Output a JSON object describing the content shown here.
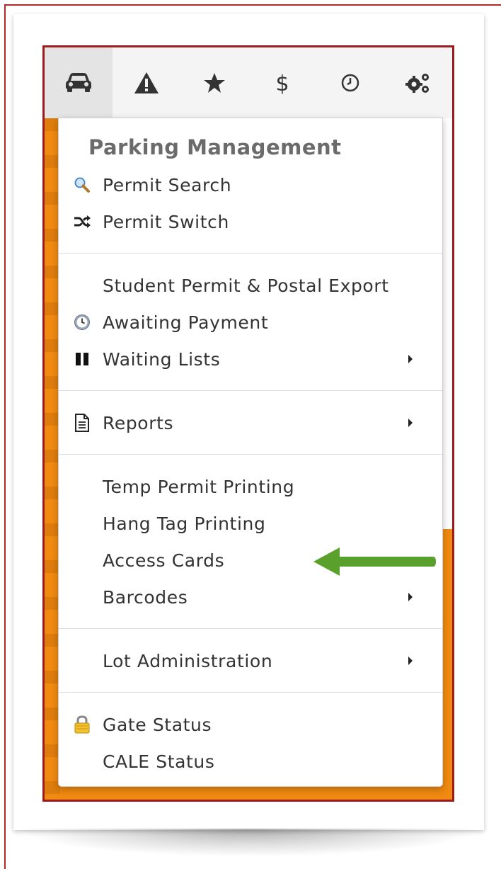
{
  "navbar": {
    "items": [
      {
        "icon": "car-icon",
        "active": true
      },
      {
        "icon": "warning-icon",
        "active": false
      },
      {
        "icon": "star-icon",
        "active": false
      },
      {
        "icon": "dollar-icon",
        "active": false
      },
      {
        "icon": "clock-icon",
        "active": false
      },
      {
        "icon": "gears-icon",
        "active": false
      }
    ]
  },
  "menu": {
    "header": "Parking Management",
    "items": {
      "permit_search": "Permit Search",
      "permit_switch": "Permit Switch",
      "student_permit_postal_export": "Student Permit & Postal Export",
      "awaiting_payment": "Awaiting Payment",
      "waiting_lists": "Waiting Lists",
      "reports": "Reports",
      "temp_permit_printing": "Temp Permit Printing",
      "hang_tag_printing": "Hang Tag Printing",
      "access_cards": "Access Cards",
      "barcodes": "Barcodes",
      "lot_administration": "Lot Administration",
      "gate_status": "Gate Status",
      "cale_status": "CALE Status"
    }
  },
  "annotation": {
    "arrow_color": "#5aa02c",
    "points_to": "Access Cards"
  },
  "colors": {
    "frame": "#9b1c1f",
    "background_orange": "#f08a10",
    "header_text": "#6b6b6b",
    "item_text": "#333333"
  }
}
